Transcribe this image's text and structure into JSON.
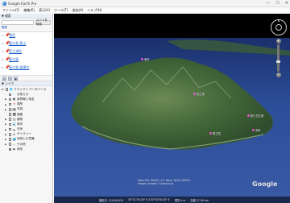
{
  "window": {
    "title": "Google Earth Pro"
  },
  "menu": [
    "ファイル(F)",
    "編集(E)",
    "表示(V)",
    "ツール(T)",
    "追加(A)",
    "ヘルプ(H)"
  ],
  "search": {
    "header": "▼ 検索",
    "placeholder": "",
    "button": "ルートを検索",
    "history": "履歴"
  },
  "results": [
    {
      "num": "1",
      "name": "竜岳",
      "desc": ""
    },
    {
      "num": "2",
      "name": "屋久島 登山",
      "desc": ""
    },
    {
      "num": "3",
      "name": "宮之浦岳",
      "desc": ""
    },
    {
      "num": "4",
      "name": "屋久島",
      "desc": ""
    },
    {
      "num": "5",
      "name": "屋久島 展望台",
      "desc": ""
    }
  ],
  "layers_header": "▼ レイヤ",
  "layers": [
    {
      "label": "プライマリ データベース",
      "icon": "globe-icon",
      "level": 0
    },
    {
      "label": "お知らせ",
      "icon": "news-icon",
      "level": 1
    },
    {
      "label": "境界線と地名",
      "icon": "border-icon",
      "level": 1
    },
    {
      "label": "場所",
      "icon": "place-icon",
      "level": 1
    },
    {
      "label": "写真",
      "icon": "photo-icon",
      "level": 1
    },
    {
      "label": "道路",
      "icon": "road-icon",
      "level": 1
    },
    {
      "label": "建物",
      "icon": "building-icon",
      "level": 1
    },
    {
      "label": "海洋",
      "icon": "ocean-icon",
      "level": 1
    },
    {
      "label": "天気",
      "icon": "weather-icon",
      "level": 1
    },
    {
      "label": "ギャラリー",
      "icon": "gallery-icon",
      "level": 1
    },
    {
      "label": "地球上の意識",
      "icon": "earth-icon",
      "level": 1
    },
    {
      "label": "その他",
      "icon": "more-icon",
      "level": 1
    },
    {
      "label": "地形",
      "icon": "terrain-icon",
      "level": 1
    }
  ],
  "view": {
    "pois": [
      {
        "label": "竜岳"
      },
      {
        "label": "宮之浦"
      },
      {
        "label": "屋久島空港"
      },
      {
        "label": "安房"
      },
      {
        "label": "尾之間"
      }
    ],
    "copyright": [
      "Data SIO, NOAA, U.S. Navy, NGA, GEBCO",
      "Image Landsat / Copernicus"
    ],
    "logo": "Google",
    "status": [
      "撮影日: 12/14/2015",
      "30°21'30.00\" N 130°30'30.00\" E",
      "標高 0 m",
      "高度 27.00 km"
    ]
  },
  "colors": {
    "sea": "#2f4f9c",
    "land": "#3f6a3a",
    "sky": "#000000",
    "link": "#1a5dc9"
  }
}
